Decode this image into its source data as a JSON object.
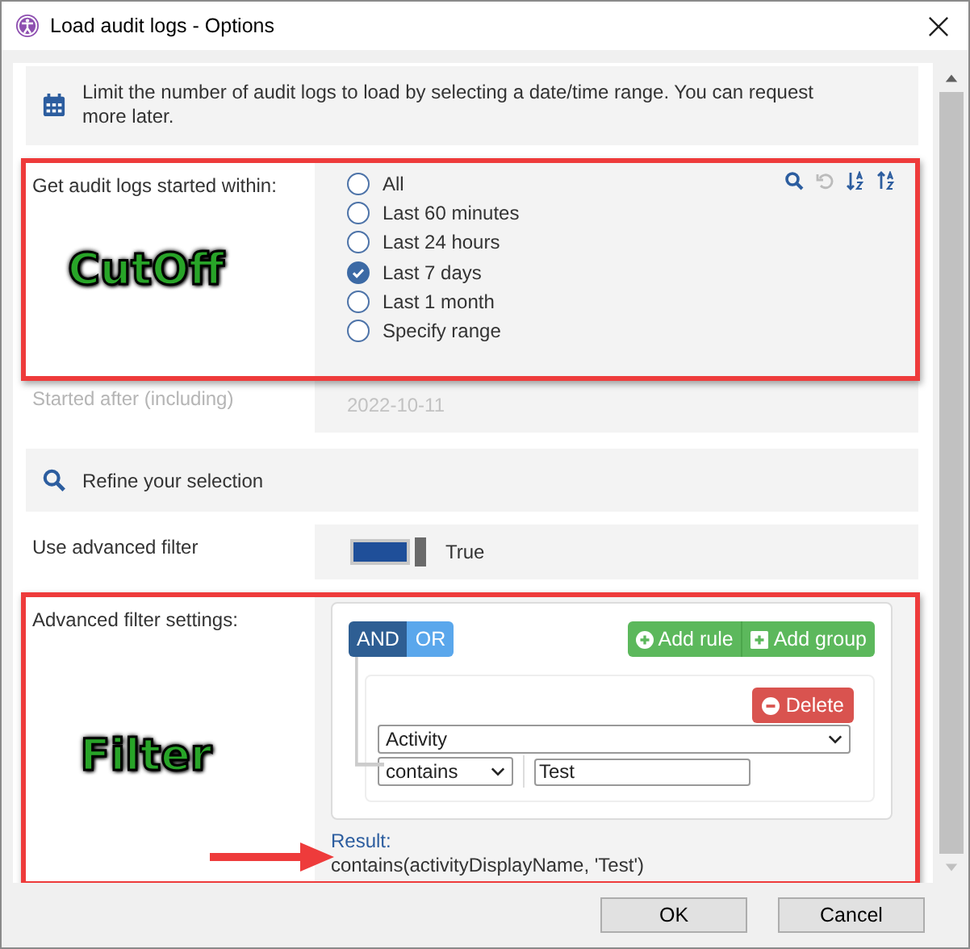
{
  "window": {
    "title": "Load audit logs - Options"
  },
  "info": {
    "text": "Limit the number of audit logs to load by selecting a date/time range. You can request more later."
  },
  "period": {
    "label": "Get audit logs started within:",
    "options": [
      {
        "label": "All",
        "selected": false
      },
      {
        "label": "Last 60 minutes",
        "selected": false
      },
      {
        "label": "Last 24 hours",
        "selected": false
      },
      {
        "label": "Last 7 days",
        "selected": true
      },
      {
        "label": "Last 1 month",
        "selected": false
      },
      {
        "label": "Specify range",
        "selected": false
      }
    ]
  },
  "started_after": {
    "label": "Started after (including)",
    "value": "2022-10-11",
    "disabled": true
  },
  "refine": {
    "text": "Refine your selection"
  },
  "advanced_filter": {
    "label": "Use advanced filter",
    "on": true,
    "value": "True"
  },
  "filter_settings": {
    "label": "Advanced filter settings:",
    "conditions": [
      {
        "label": "AND",
        "selected": true
      },
      {
        "label": "OR",
        "selected": false
      }
    ],
    "add_rule": "Add rule",
    "add_group": "Add group",
    "rule": {
      "delete": "Delete",
      "field": "Activity",
      "operator": "contains",
      "value": "Test"
    },
    "result_label": "Result:",
    "result": "contains(activityDisplayName, 'Test')"
  },
  "annotations": [
    {
      "text": "CutOff"
    },
    {
      "text": "Filter"
    }
  ],
  "buttons": [
    "OK",
    "Cancel"
  ]
}
